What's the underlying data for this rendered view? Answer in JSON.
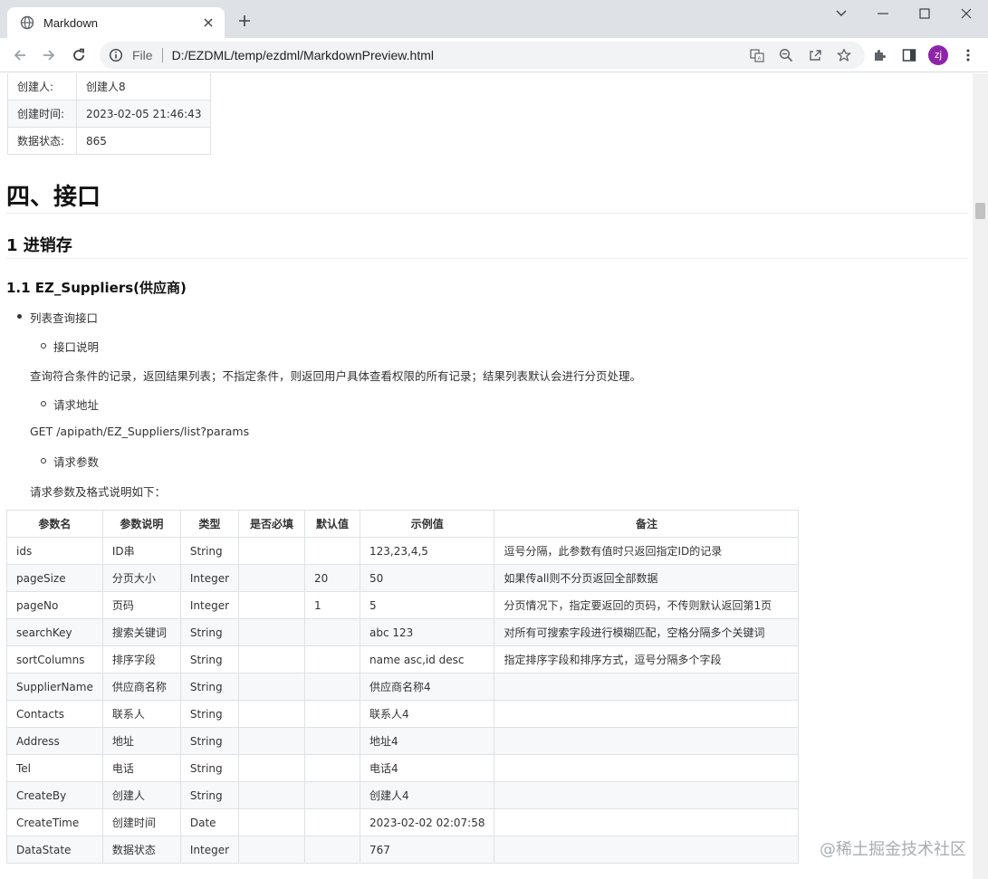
{
  "browser": {
    "tab_title": "Markdown",
    "url_scheme": "File",
    "url": "D:/EZDML/temp/ezdml/MarkdownPreview.html",
    "profile_initials": "zj",
    "profile_color": "#8e24aa"
  },
  "top_table": {
    "rows": [
      {
        "label": "创建人:",
        "value": "创建人8"
      },
      {
        "label": "创建时间:",
        "value": "2023-02-05 21:46:43"
      },
      {
        "label": "数据状态:",
        "value": "865"
      }
    ]
  },
  "section": {
    "h1": "四、接口",
    "h2": "1 进销存",
    "h3": "1.1 EZ_Suppliers(供应商)"
  },
  "list": {
    "item": "列表查询接口",
    "desc_heading": "接口说明",
    "desc_text": "查询符合条件的记录，返回结果列表；不指定条件，则返回用户具体查看权限的所有记录；结果列表默认会进行分页处理。",
    "url_heading": "请求地址",
    "url_text": "GET /apipath/EZ_Suppliers/list?params",
    "params_heading": "请求参数",
    "params_text": "请求参数及格式说明如下："
  },
  "params_table": {
    "headers": [
      "参数名",
      "参数说明",
      "类型",
      "是否必填",
      "默认值",
      "示例值",
      "备注"
    ],
    "rows": [
      [
        "ids",
        "ID串",
        "String",
        "",
        "",
        "123,23,4,5",
        "逗号分隔，此参数有值时只返回指定ID的记录"
      ],
      [
        "pageSize",
        "分页大小",
        "Integer",
        "",
        "20",
        "50",
        "如果传all则不分页返回全部数据"
      ],
      [
        "pageNo",
        "页码",
        "Integer",
        "",
        "1",
        "5",
        "分页情况下，指定要返回的页码，不传则默认返回第1页"
      ],
      [
        "searchKey",
        "搜索关键词",
        "String",
        "",
        "",
        "abc 123",
        "对所有可搜索字段进行模糊匹配，空格分隔多个关键词"
      ],
      [
        "sortColumns",
        "排序字段",
        "String",
        "",
        "",
        "name asc,id desc",
        "指定排序字段和排序方式，逗号分隔多个字段"
      ],
      [
        "SupplierName",
        "供应商名称",
        "String",
        "",
        "",
        "供应商名称4",
        ""
      ],
      [
        "Contacts",
        "联系人",
        "String",
        "",
        "",
        "联系人4",
        ""
      ],
      [
        "Address",
        "地址",
        "String",
        "",
        "",
        "地址4",
        ""
      ],
      [
        "Tel",
        "电话",
        "String",
        "",
        "",
        "电话4",
        ""
      ],
      [
        "CreateBy",
        "创建人",
        "String",
        "",
        "",
        "创建人4",
        ""
      ],
      [
        "CreateTime",
        "创建时间",
        "Date",
        "",
        "",
        "2023-02-02 02:07:58",
        ""
      ],
      [
        "DataState",
        "数据状态",
        "Integer",
        "",
        "",
        "767",
        ""
      ]
    ]
  },
  "watermark": "@稀土掘金技术社区"
}
